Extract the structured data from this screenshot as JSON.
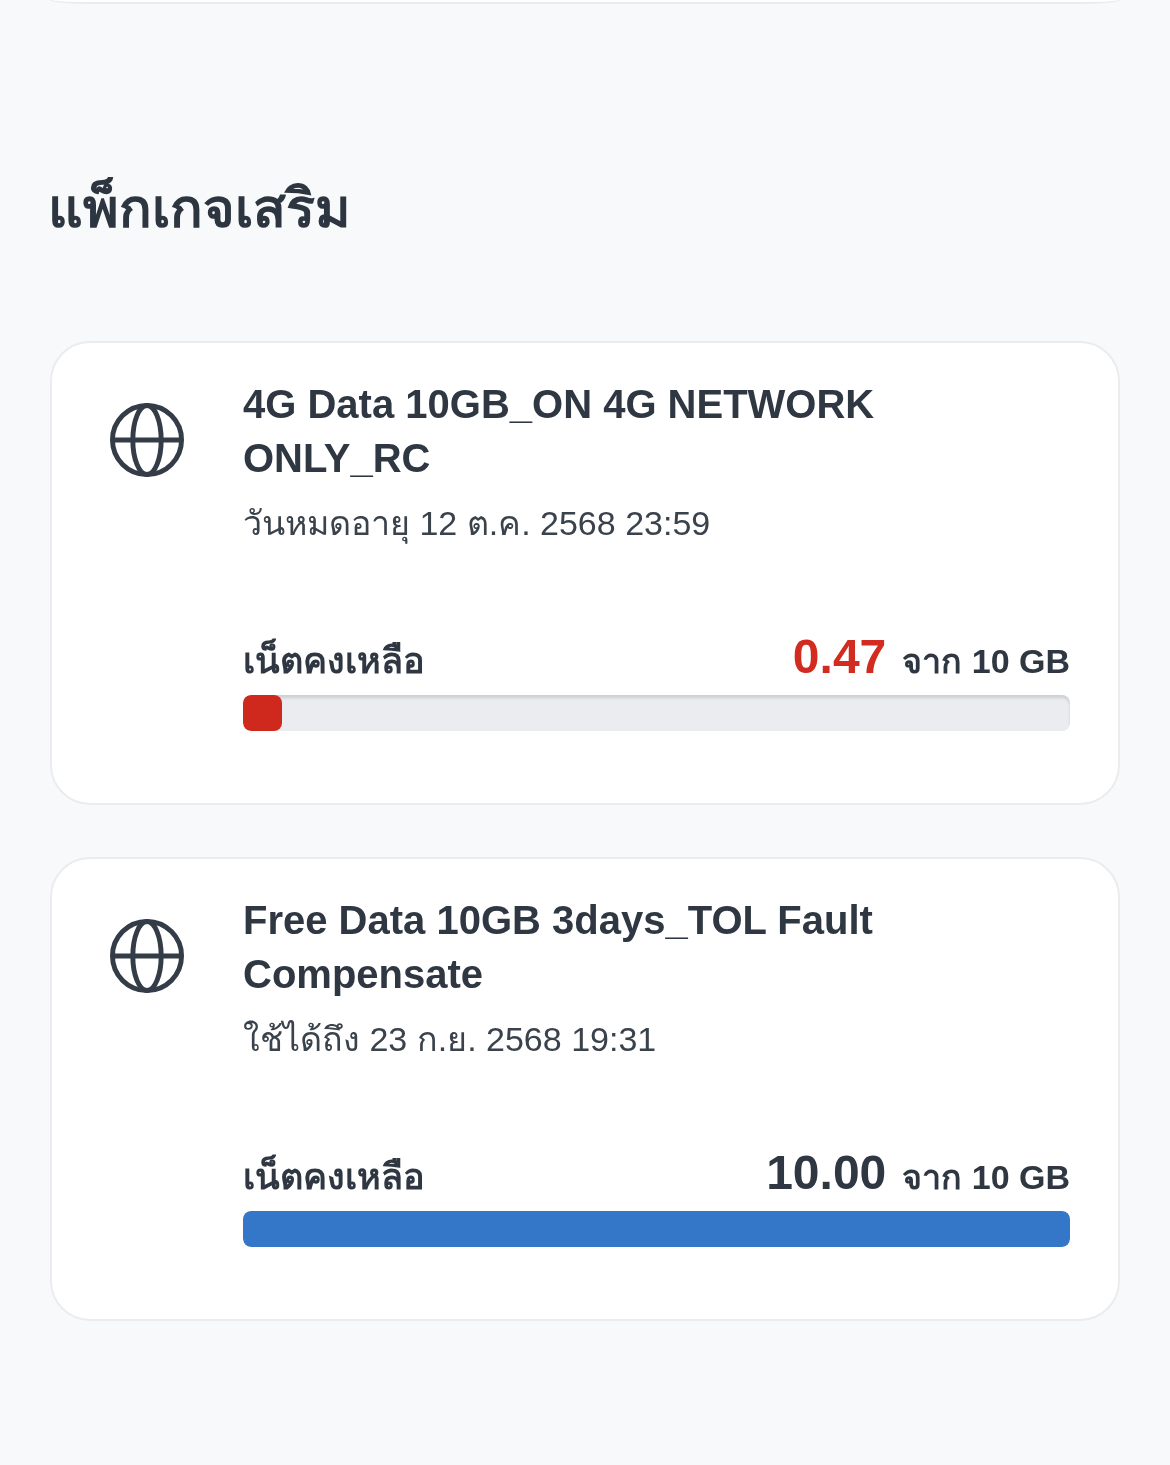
{
  "section_title": "แพ็กเกจเสริม",
  "packages": [
    {
      "name": "4G Data 10GB_ON 4G NETWORK ONLY_RC",
      "validity": "วันหมดอายุ 12 ต.ค. 2568 23:59",
      "remaining_label": "เน็ตคงเหลือ",
      "remaining": "0.47",
      "total": "จาก 10 GB",
      "low": true,
      "level": 0.047
    },
    {
      "name": "Free Data 10GB 3days_TOL Fault Compensate",
      "validity": "ใช้ได้ถึง 23 ก.ย. 2568 19:31",
      "remaining_label": "เน็ตคงเหลือ",
      "remaining": "10.00",
      "total": "จาก 10 GB",
      "low": false,
      "level": 1
    }
  ]
}
